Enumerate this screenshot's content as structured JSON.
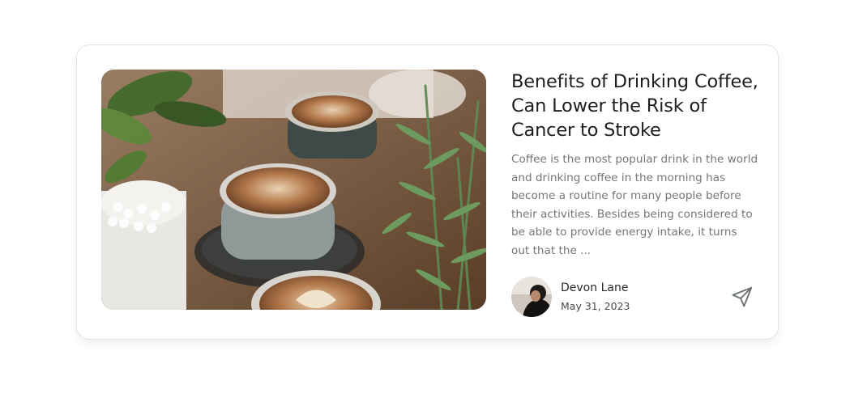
{
  "article": {
    "title": "Benefits of Drinking Coffee, Can Lower the Risk of Cancer to Stroke",
    "excerpt": "Coffee is the most popular drink in the world and drinking coffee in the morning has become a routine for many people before their activities. Besides being considered to be able to provide energy intake, it turns out that the ...",
    "image_icon": "coffee-photo"
  },
  "author": {
    "name": "Devon Lane",
    "date": "May 31, 2023",
    "avatar_icon": "avatar-photo"
  },
  "actions": {
    "share_icon": "send-icon"
  },
  "colors": {
    "title": "#1f1f1f",
    "excerpt": "#767676",
    "card_border": "#e3e3e3"
  }
}
